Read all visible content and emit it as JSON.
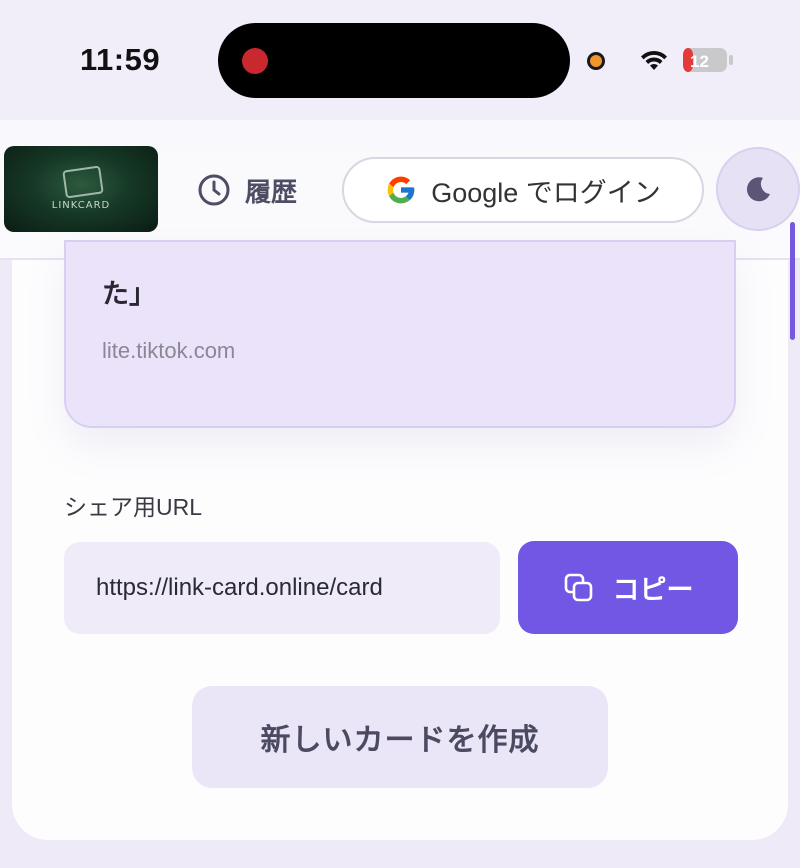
{
  "status_bar": {
    "time": "11:59",
    "battery": "12"
  },
  "header": {
    "logo_text": "LINKCARD",
    "history_label": "履歴",
    "google_login_label": "Google でログイン"
  },
  "preview": {
    "title_tail": "た」",
    "domain": "lite.tiktok.com"
  },
  "share": {
    "label": "シェア用URL",
    "url_value": "https://link-card.online/card",
    "copy_label": "コピー"
  },
  "new_card_label": "新しいカードを作成",
  "colors": {
    "accent": "#7256e4",
    "card_bg": "#ebe3f9",
    "page_bg": "#efeaf8"
  }
}
